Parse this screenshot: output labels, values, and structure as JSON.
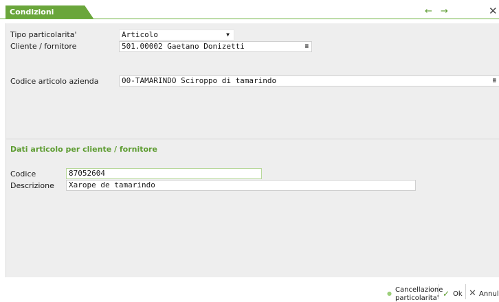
{
  "window": {
    "title": "Condizioni particolari",
    "nav_arrows": "← →",
    "close_glyph": "✕"
  },
  "form": {
    "tipo_label": "Tipo particolarita'",
    "tipo_value": "Articolo",
    "cliente_label": "Cliente / fornitore",
    "cliente_value": "501.00002 Gaetano Donizetti",
    "codice_articolo_label": "Codice articolo azienda",
    "codice_articolo_value": "00-TAMARINDO Sciroppo di tamarindo"
  },
  "section": {
    "title": "Dati articolo per cliente / fornitore",
    "codice_label": "Codice",
    "codice_value": "87052604",
    "descrizione_label": "Descrizione",
    "descrizione_value": "Xarope de tamarindo"
  },
  "footer": {
    "cancel_line1": "Cancellazione",
    "cancel_line2": "particolarita'",
    "ok_label": "Ok",
    "annulla_label": "Annull"
  },
  "colors": {
    "accent": "#6aa63b"
  }
}
